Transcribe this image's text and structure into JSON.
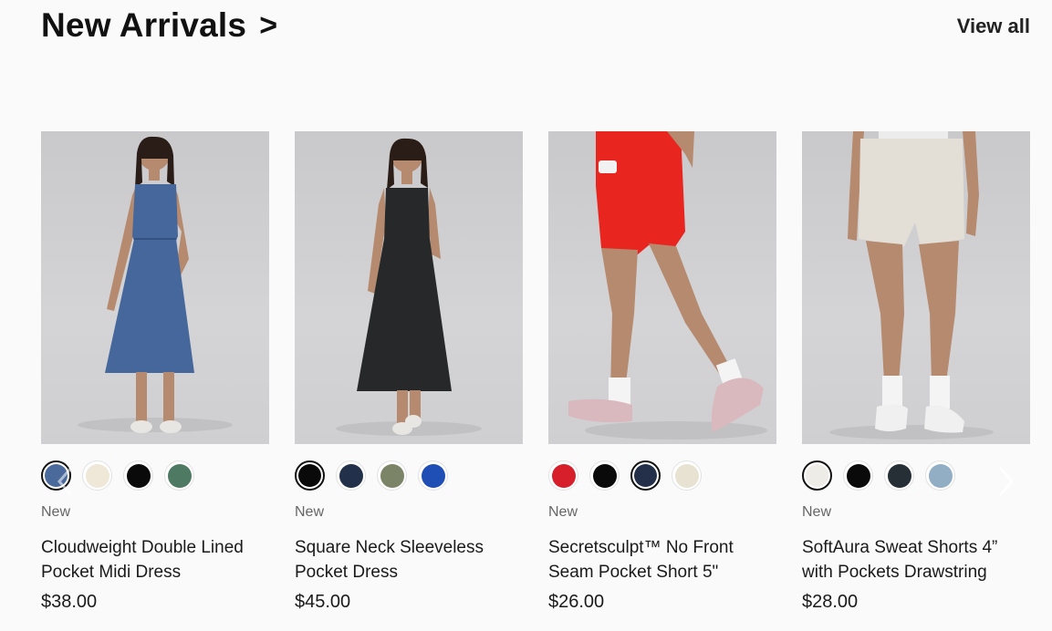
{
  "section": {
    "title": "New Arrivals",
    "title_arrow": ">",
    "view_all": "View all"
  },
  "products": [
    {
      "badge": "New",
      "name": "Cloudweight Double Lined Pocket Midi Dress",
      "price": "$38.00",
      "swatches": [
        "#4a6a9c",
        "#efe8d8",
        "#0a0a0a",
        "#4e7a64"
      ],
      "selected_swatch": 0,
      "garment_color": "#45679c"
    },
    {
      "badge": "New",
      "name": "Square Neck Sleeveless Pocket Dress",
      "price": "$45.00",
      "swatches": [
        "#0a0a0a",
        "#22304a",
        "#7c8467",
        "#1f4fb5"
      ],
      "selected_swatch": 0,
      "garment_color": "#26282a"
    },
    {
      "badge": "New",
      "name": "Secretsculpt™ No Front Seam Pocket Short 5\"",
      "price": "$26.00",
      "swatches": [
        "#d71f2b",
        "#0a0a0a",
        "#24304a",
        "#e7e2d2"
      ],
      "selected_swatch": 2,
      "garment_color": "#e8251f"
    },
    {
      "badge": "New",
      "name": "SoftAura Sweat Shorts 4” with Pockets Drawstring",
      "price": "$28.00",
      "swatches": [
        "#eeece6",
        "#0a0a0a",
        "#262f36",
        "#92aec5"
      ],
      "selected_swatch": 0,
      "garment_color": "#e3dfd6"
    }
  ],
  "icons": {
    "prev": "chevron-left-icon",
    "next": "chevron-right-icon"
  }
}
